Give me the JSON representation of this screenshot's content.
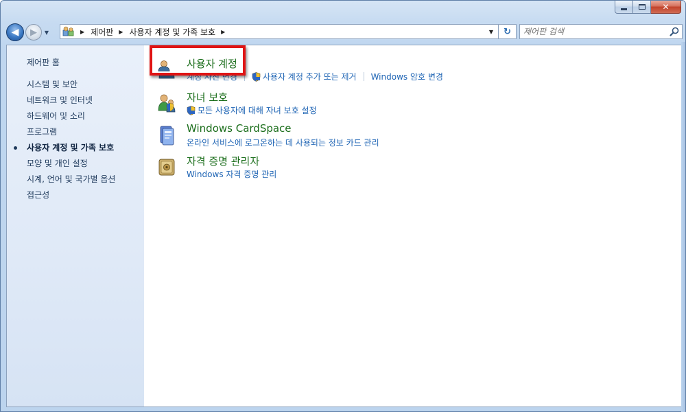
{
  "window": {
    "caption_buttons": {
      "minimize": "minimize-button",
      "maximize": "maximize-button",
      "close_label": "✕"
    }
  },
  "nav": {
    "back_label": "◀",
    "forward_label": "▶",
    "recent_label": "▼",
    "refresh_label": "↻"
  },
  "address": {
    "crumbs": [
      "제어판",
      "사용자 계정 및 가족 보호"
    ],
    "dropdown_label": "▼"
  },
  "search": {
    "placeholder": "제어판 검색"
  },
  "sidebar": {
    "home": "제어판 홈",
    "items": [
      {
        "label": "시스템 및 보안",
        "active": false
      },
      {
        "label": "네트워크 및 인터넷",
        "active": false
      },
      {
        "label": "하드웨어 및 소리",
        "active": false
      },
      {
        "label": "프로그램",
        "active": false
      },
      {
        "label": "사용자 계정 및 가족 보호",
        "active": true
      },
      {
        "label": "모양 및 개인 설정",
        "active": false
      },
      {
        "label": "시계, 언어 및 국가별 옵션",
        "active": false
      },
      {
        "label": "접근성",
        "active": false
      }
    ]
  },
  "categories": [
    {
      "title": "사용자 계정",
      "icon": "user-accounts-icon",
      "links": [
        {
          "label": "계정 사진 변경",
          "shield": false
        },
        {
          "label": "사용자 계정 추가 또는 제거",
          "shield": true
        },
        {
          "label": "Windows 암호 변경",
          "shield": false
        }
      ]
    },
    {
      "title": "자녀 보호",
      "icon": "parental-controls-icon",
      "links": [
        {
          "label": "모든 사용자에 대해 자녀 보호 설정",
          "shield": true
        }
      ]
    },
    {
      "title": "Windows CardSpace",
      "icon": "cardspace-icon",
      "links": [
        {
          "label": "온라인 서비스에 로그온하는 데 사용되는 정보 카드 관리",
          "shield": false
        }
      ]
    },
    {
      "title": "자격 증명 관리자",
      "icon": "credential-manager-icon",
      "links": [
        {
          "label": "Windows 자격 증명 관리",
          "shield": false
        }
      ]
    }
  ],
  "colors": {
    "link": "#1e64b4",
    "category_title": "#1a6d1a",
    "highlight": "#e01414"
  }
}
